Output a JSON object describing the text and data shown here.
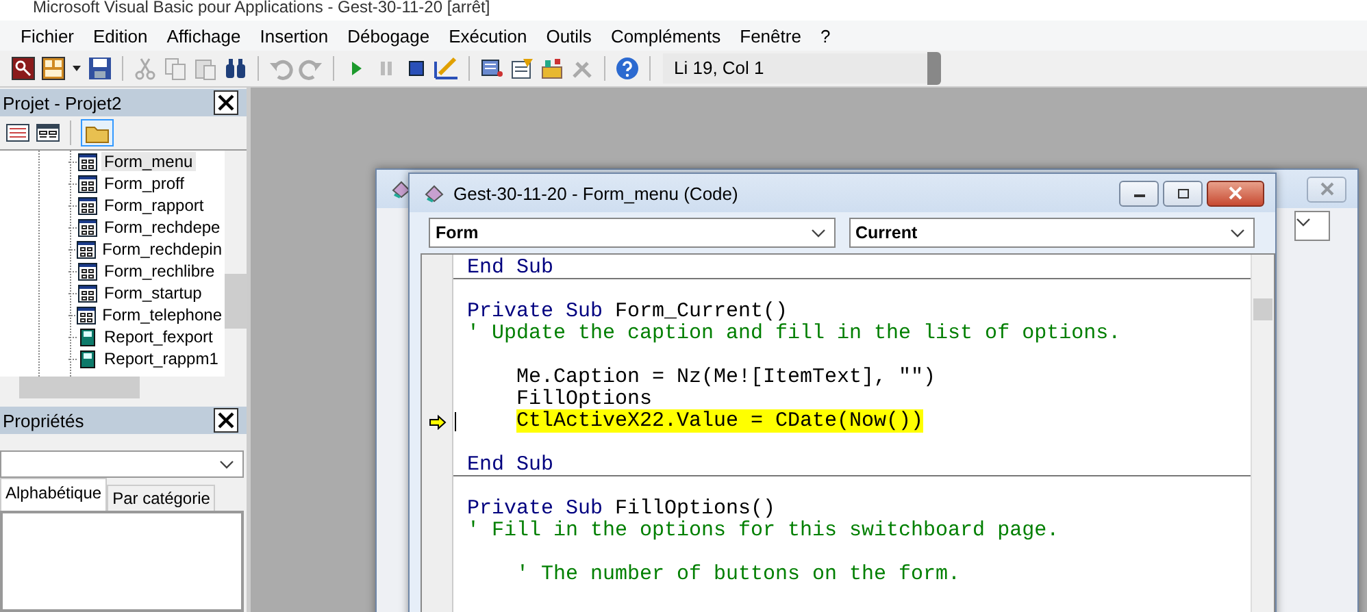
{
  "window": {
    "title": "Microsoft Visual Basic pour Applications - Gest-30-11-20 [arrêt]"
  },
  "menu": [
    "Fichier",
    "Edition",
    "Affichage",
    "Insertion",
    "Débogage",
    "Exécution",
    "Outils",
    "Compléments",
    "Fenêtre",
    "?"
  ],
  "toolbar": {
    "position": "Li 19, Col 1"
  },
  "project": {
    "title": "Projet - Projet2",
    "items": [
      {
        "label": "Form_menu",
        "kind": "form",
        "selected": true
      },
      {
        "label": "Form_proff",
        "kind": "form",
        "selected": false
      },
      {
        "label": "Form_rapport",
        "kind": "form",
        "selected": false
      },
      {
        "label": "Form_rechdepe",
        "kind": "form",
        "selected": false
      },
      {
        "label": "Form_rechdepin",
        "kind": "form",
        "selected": false
      },
      {
        "label": "Form_rechlibre",
        "kind": "form",
        "selected": false
      },
      {
        "label": "Form_startup",
        "kind": "form",
        "selected": false
      },
      {
        "label": "Form_telephone",
        "kind": "form",
        "selected": false
      },
      {
        "label": "Report_fexport",
        "kind": "report",
        "selected": false
      },
      {
        "label": "Report_rappm1",
        "kind": "report",
        "selected": false
      }
    ]
  },
  "properties": {
    "title": "Propriétés",
    "tabs": [
      {
        "label": "Alphabétique",
        "selected": true
      },
      {
        "label": "Par catégorie",
        "selected": false
      }
    ]
  },
  "code_window": {
    "title": "Gest-30-11-20 - Form_menu (Code)",
    "object": "Form",
    "procedure": "Current",
    "lines": [
      {
        "segments": [
          {
            "text": "End Sub",
            "kind": "keyword"
          }
        ],
        "divider_after": true
      },
      {
        "kind": "blank"
      },
      {
        "segments": [
          {
            "text": "Private Sub",
            "kind": "keyword"
          },
          {
            "text": " Form_Current()",
            "kind": "plain"
          }
        ]
      },
      {
        "segments": [
          {
            "text": "' Update the caption and fill in the list of options.",
            "kind": "comment"
          }
        ]
      },
      {
        "kind": "blank"
      },
      {
        "segments": [
          {
            "text": "Me.Caption = Nz(Me![ItemText], \"\")",
            "kind": "plain"
          }
        ],
        "indented": true
      },
      {
        "segments": [
          {
            "text": "FillOptions",
            "kind": "plain"
          }
        ],
        "indented": true
      },
      {
        "segments": [
          {
            "text": "CtlActiveX22.Value = CDate(Now())",
            "kind": "plain"
          }
        ],
        "indented": true,
        "execution_point": true
      },
      {
        "kind": "blank"
      },
      {
        "segments": [
          {
            "text": "End Sub",
            "kind": "keyword"
          }
        ],
        "divider_after": true
      },
      {
        "kind": "blank"
      },
      {
        "segments": [
          {
            "text": "Private Sub",
            "kind": "keyword"
          },
          {
            "text": " FillOptions()",
            "kind": "plain"
          }
        ]
      },
      {
        "segments": [
          {
            "text": "' Fill in the options for this switchboard page.",
            "kind": "comment"
          }
        ]
      },
      {
        "kind": "blank"
      },
      {
        "segments": [
          {
            "text": "' The number of buttons on the form.",
            "kind": "comment"
          }
        ],
        "indented": true
      }
    ]
  }
}
